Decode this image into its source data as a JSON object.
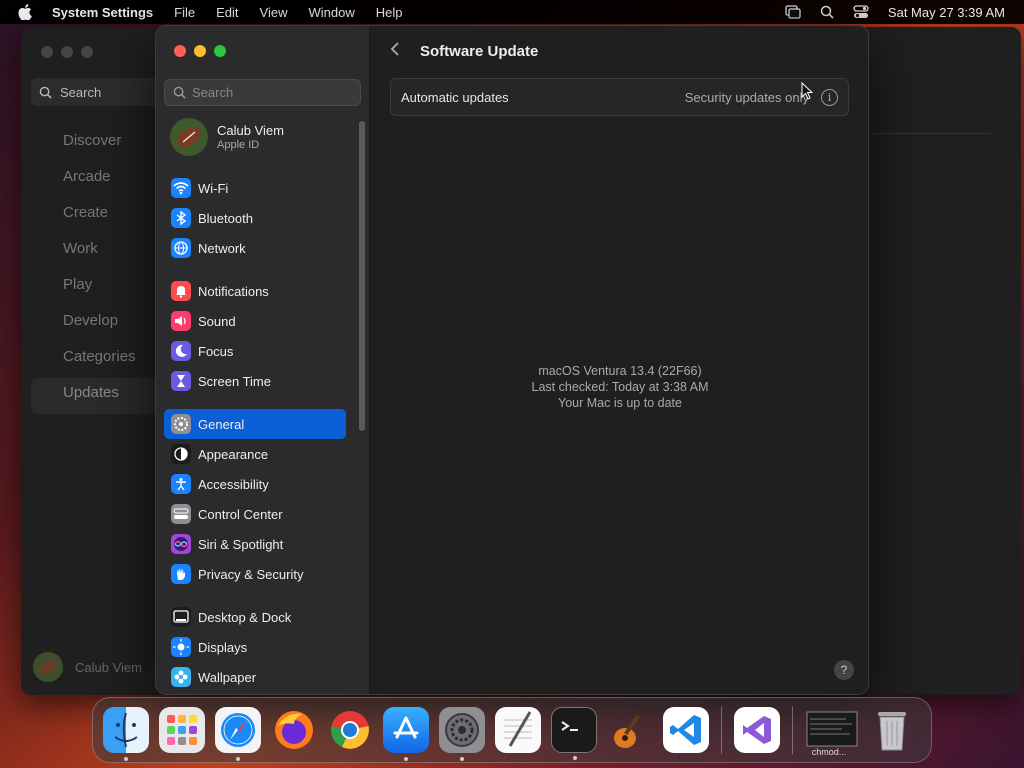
{
  "menubar": {
    "app": "System Settings",
    "items": [
      "File",
      "Edit",
      "View",
      "Window",
      "Help"
    ],
    "clock": "Sat May 27  3:39 AM"
  },
  "back_window": {
    "search_placeholder": "Search",
    "nav": [
      "Discover",
      "Arcade",
      "Create",
      "Work",
      "Play",
      "Develop",
      "Categories",
      "Updates"
    ],
    "selected": "Updates",
    "user_name": "Calub Viem"
  },
  "settings": {
    "search_placeholder": "Search",
    "user": {
      "name": "Calub Viem",
      "sub": "Apple ID"
    },
    "groups": [
      [
        {
          "label": "Wi-Fi",
          "icon": "wifi-icon",
          "color": "#1a84ff"
        },
        {
          "label": "Bluetooth",
          "icon": "bluetooth-icon",
          "color": "#1a84ff"
        },
        {
          "label": "Network",
          "icon": "globe-icon",
          "color": "#1a84ff"
        }
      ],
      [
        {
          "label": "Notifications",
          "icon": "bell-icon",
          "color": "#ff4b4b"
        },
        {
          "label": "Sound",
          "icon": "speaker-icon",
          "color": "#ff3b6b"
        },
        {
          "label": "Focus",
          "icon": "moon-icon",
          "color": "#6a5ae0"
        },
        {
          "label": "Screen Time",
          "icon": "hourglass-icon",
          "color": "#6a5ae0"
        }
      ],
      [
        {
          "label": "General",
          "icon": "gear-icon",
          "color": "#8e8e93",
          "selected": true
        },
        {
          "label": "Appearance",
          "icon": "appearance-icon",
          "color": "#1c1c1e"
        },
        {
          "label": "Accessibility",
          "icon": "accessibility-icon",
          "color": "#1a84ff"
        },
        {
          "label": "Control Center",
          "icon": "toggles-icon",
          "color": "#8e8e93"
        },
        {
          "label": "Siri & Spotlight",
          "icon": "siri-icon",
          "color": "#a245d8"
        },
        {
          "label": "Privacy & Security",
          "icon": "hand-icon",
          "color": "#1a84ff"
        }
      ],
      [
        {
          "label": "Desktop & Dock",
          "icon": "dock-icon",
          "color": "#1c1c1e"
        },
        {
          "label": "Displays",
          "icon": "sun-icon",
          "color": "#1a84ff"
        },
        {
          "label": "Wallpaper",
          "icon": "flower-icon",
          "color": "#37b4f0"
        }
      ]
    ],
    "main": {
      "title": "Software Update",
      "auto_label": "Automatic updates",
      "auto_value": "Security updates only",
      "status_lines": [
        "macOS Ventura 13.4 (22F66)",
        "Last checked: Today at 3:38 AM",
        "Your Mac is up to date"
      ],
      "help": "?"
    }
  },
  "dock": {
    "apps": [
      {
        "name": "finder-app",
        "running": true
      },
      {
        "name": "launchpad-app",
        "running": false
      },
      {
        "name": "safari-app",
        "running": true
      },
      {
        "name": "firefox-app",
        "running": false
      },
      {
        "name": "chrome-app",
        "running": false
      },
      {
        "name": "app-store-app",
        "running": true
      },
      {
        "name": "system-settings-app",
        "running": true
      },
      {
        "name": "textedit-app",
        "running": false
      },
      {
        "name": "terminal-app",
        "running": true
      },
      {
        "name": "garageband-app",
        "running": false
      },
      {
        "name": "vscode-app",
        "running": false
      },
      {
        "name": "visual-studio-app",
        "running": false
      }
    ],
    "minimized_label": "chmod..."
  }
}
